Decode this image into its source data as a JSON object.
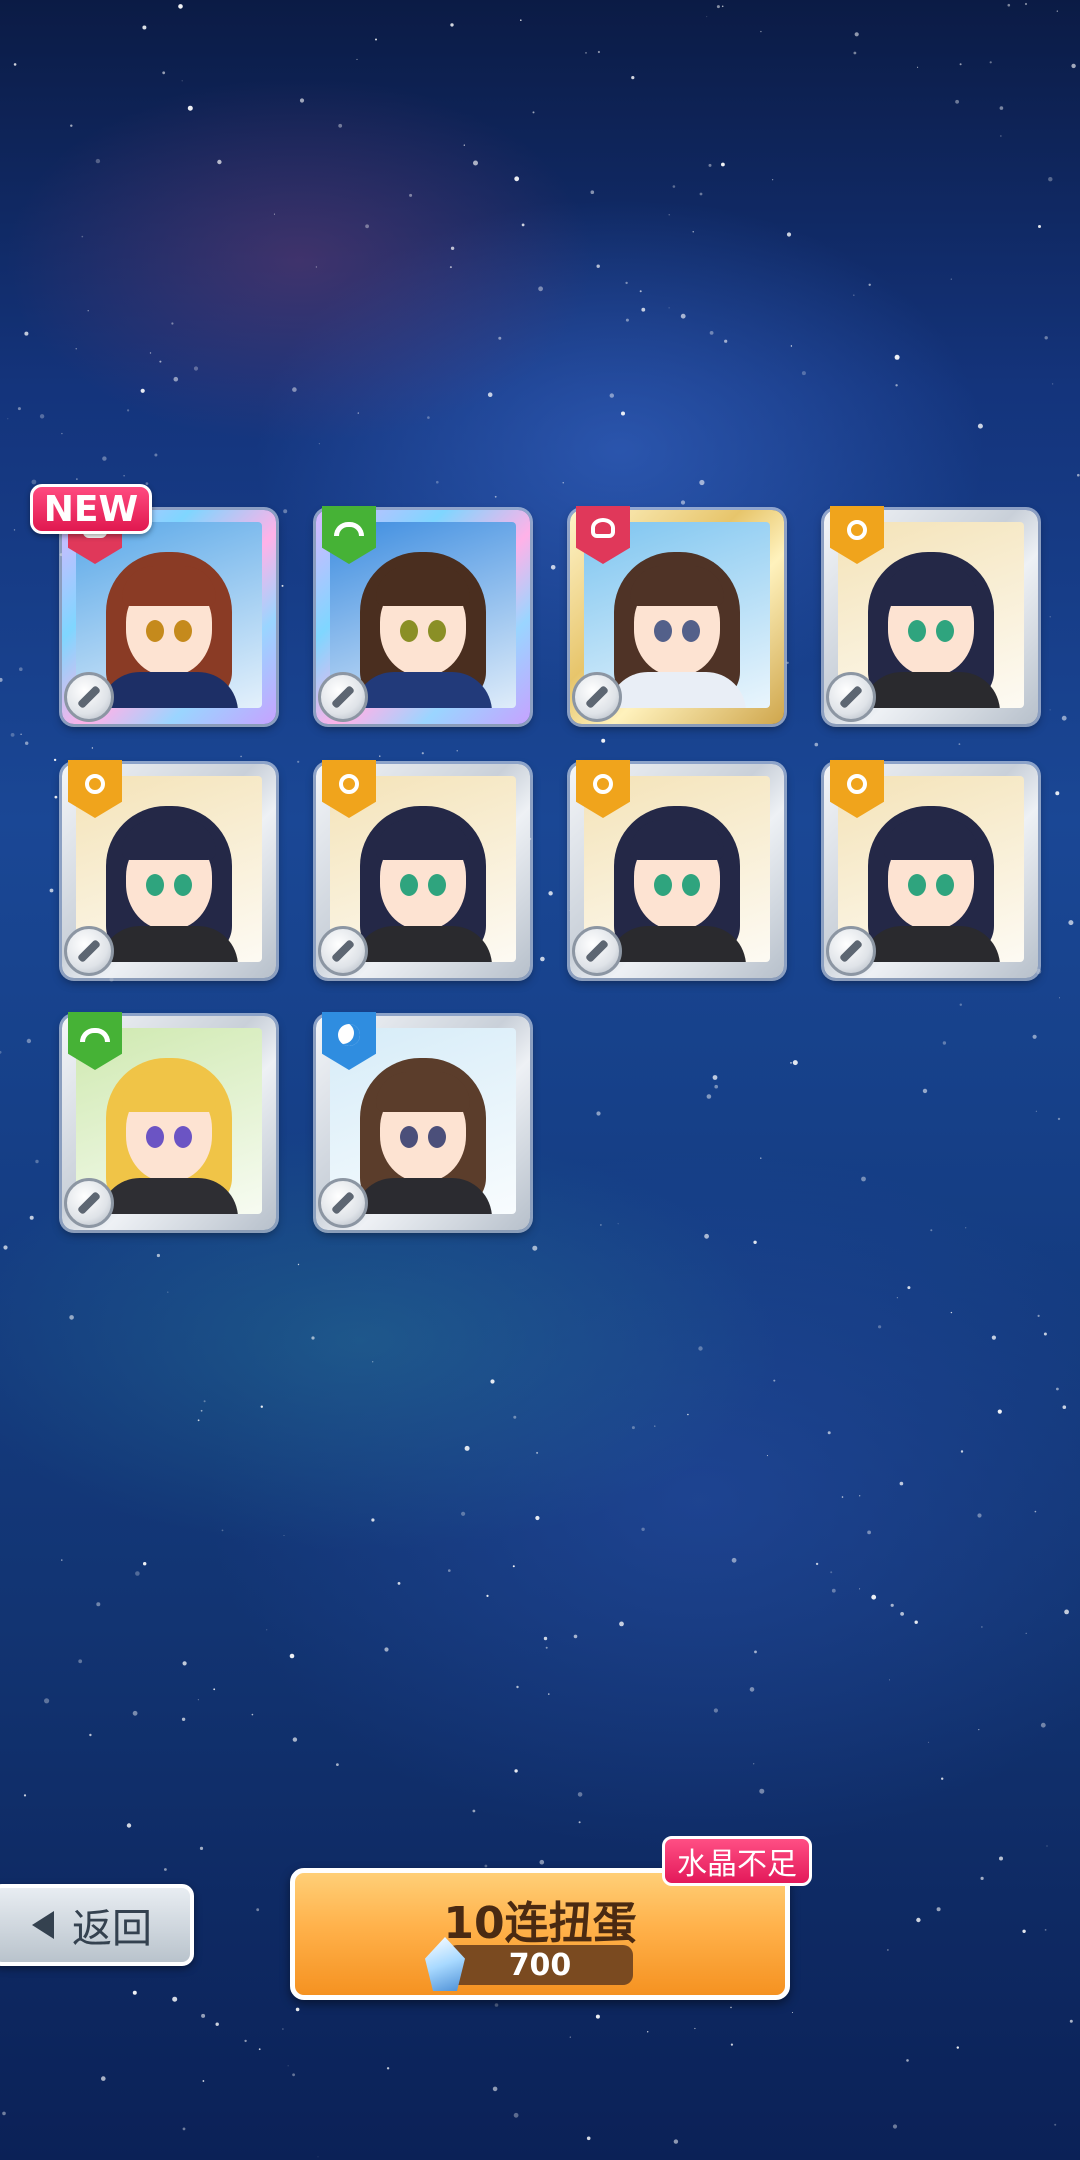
{
  "results": {
    "new_badge": "NEW",
    "cards": [
      {
        "id": "card-1",
        "attribute": "red-crest-icon",
        "weapon": "sword-icon",
        "frame": "rainbow",
        "is_new": true,
        "hair": "#8a3b25",
        "eyes": "#c58a1c",
        "bg": "#5aa8e8",
        "outfit": "#1d2f66"
      },
      {
        "id": "card-2",
        "attribute": "green-arc-icon",
        "weapon": "sword-icon",
        "frame": "rainbow",
        "is_new": false,
        "hair": "#4a2e1f",
        "eyes": "#8a8f26",
        "bg": "#3d8de0",
        "outfit": "#223a7a"
      },
      {
        "id": "card-3",
        "attribute": "red-crest-icon",
        "weapon": "sword-icon",
        "frame": "gold",
        "is_new": false,
        "hair": "#4f3326",
        "eyes": "#53608a",
        "bg": "#7ec5f0",
        "outfit": "#e9eef6"
      },
      {
        "id": "card-4",
        "attribute": "sun-icon",
        "weapon": "rifle-icon",
        "frame": "silver",
        "is_new": false,
        "hair": "#242847",
        "eyes": "#2fa47e",
        "bg": "#f4e3b8",
        "outfit": "#2a2a2e"
      },
      {
        "id": "card-5",
        "attribute": "sun-icon",
        "weapon": "rifle-icon",
        "frame": "silver",
        "is_new": false,
        "hair": "#242847",
        "eyes": "#2fa47e",
        "bg": "#f4e3b8",
        "outfit": "#2a2a2e"
      },
      {
        "id": "card-6",
        "attribute": "sun-icon",
        "weapon": "rifle-icon",
        "frame": "silver",
        "is_new": false,
        "hair": "#242847",
        "eyes": "#2fa47e",
        "bg": "#f4e3b8",
        "outfit": "#2a2a2e"
      },
      {
        "id": "card-7",
        "attribute": "sun-icon",
        "weapon": "rifle-icon",
        "frame": "silver",
        "is_new": false,
        "hair": "#242847",
        "eyes": "#2fa47e",
        "bg": "#f4e3b8",
        "outfit": "#2a2a2e"
      },
      {
        "id": "card-8",
        "attribute": "sun-icon",
        "weapon": "rifle-icon",
        "frame": "silver",
        "is_new": false,
        "hair": "#242847",
        "eyes": "#2fa47e",
        "bg": "#f4e3b8",
        "outfit": "#2a2a2e"
      },
      {
        "id": "card-9",
        "attribute": "green-arc-icon",
        "weapon": "missile-icon",
        "frame": "silver",
        "is_new": false,
        "hair": "#f0c447",
        "eyes": "#6b54c4",
        "bg": "#cfe9b0",
        "outfit": "#2e2e33"
      },
      {
        "id": "card-10",
        "attribute": "blue-moon-icon",
        "weapon": "sword-icon",
        "frame": "silver",
        "is_new": false,
        "hair": "#5b3d2b",
        "eyes": "#4b4f7a",
        "bg": "#d6ecf8",
        "outfit": "#2b2b30"
      }
    ]
  },
  "attribute_colors": {
    "red-crest-icon": "#e0385a",
    "green-arc-icon": "#46b236",
    "sun-icon": "#f0a41c",
    "blue-moon-icon": "#2f8de0"
  },
  "footer": {
    "back_label": "返回",
    "gacha_label": "10连扭蛋",
    "cost": "700",
    "cost_icon": "crystal-icon",
    "shortage_label": "水晶不足"
  }
}
